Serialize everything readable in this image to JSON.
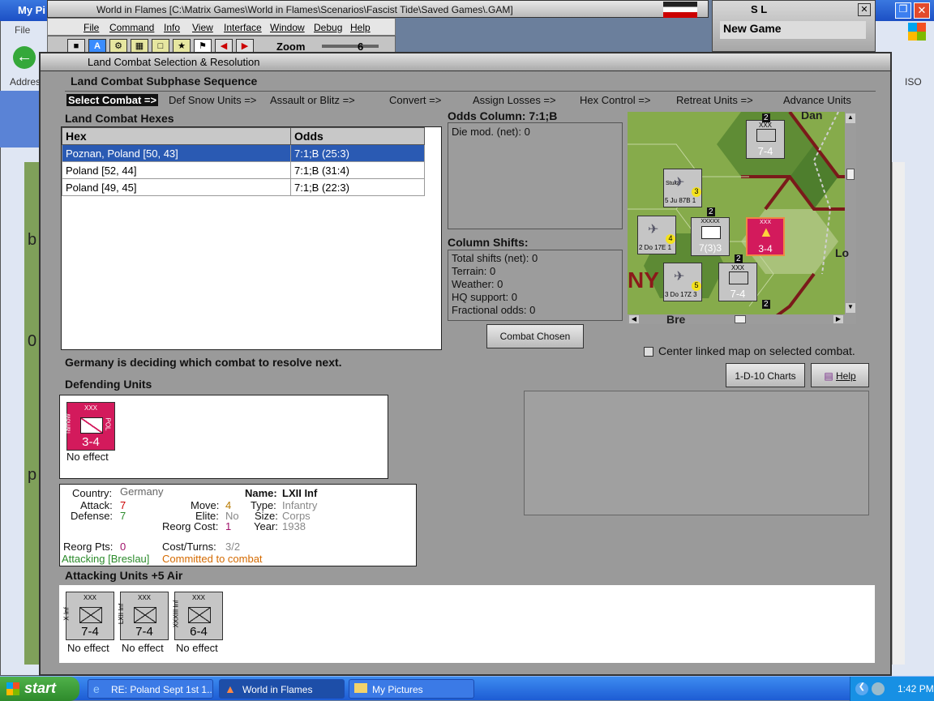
{
  "bg": {
    "my_pictures_title": "My Pi",
    "file_menu": "File",
    "address_label": "Addres",
    "side_letter1": "b",
    "side_letter2": "0",
    "side_letter3": "p",
    "right_letter": "ISO"
  },
  "sl_window": {
    "title": "S L",
    "new_game": "New Game"
  },
  "main_window": {
    "title": "World in Flames [C:\\Matrix Games\\World in Flames\\Scenarios\\Fascist Tide\\Saved Games\\.GAM]",
    "menu": [
      "File",
      "Command",
      "Info",
      "View",
      "Interface",
      "Window",
      "Debug",
      "Help"
    ],
    "zoom_label": "Zoom",
    "zoom_value": "6"
  },
  "dialog": {
    "title": "Land Combat Selection & Resolution",
    "sequence_title": "Land Combat Subphase Sequence",
    "sequence": [
      "Select Combat =>",
      "Def Snow Units =>",
      "Assault or Blitz =>",
      "Convert =>",
      "Assign Losses =>",
      "Hex Control =>",
      "Retreat Units =>",
      "Advance Units"
    ],
    "hexes_title": "Land Combat Hexes",
    "table": {
      "headers": [
        "Hex",
        "Odds"
      ],
      "rows": [
        [
          "Poznan, Poland [50, 43]",
          "7:1;B (25:3)"
        ],
        [
          "Poland [52, 44]",
          "7:1;B (31:4)"
        ],
        [
          "Poland [49, 45]",
          "7:1;B (22:3)"
        ]
      ]
    },
    "odds_column": "Odds Column: 7:1;B",
    "die_mod": "Die mod. (net): 0",
    "column_shifts_title": "Column Shifts:",
    "shifts": [
      "Total shifts (net): 0",
      "Terrain: 0",
      "Weather: 0",
      "HQ support: 0",
      "Fractional odds: 0"
    ],
    "combat_chosen": "Combat Chosen",
    "center_linked": "Center linked map on selected combat.",
    "charts_button": "1-D-10 Charts",
    "help_button": "Help",
    "status": "Germany is deciding which combat to resolve next.",
    "defending_title": "Defending Units",
    "defender": {
      "size": "XXX",
      "name": "Tarnow",
      "nation": "POL",
      "value": "3-4",
      "effect": "No effect"
    },
    "info": {
      "country_label": "Country:",
      "country": "Germany",
      "attack_label": "Attack:",
      "attack": "7",
      "defense_label": "Defense:",
      "defense": "7",
      "move_label": "Move:",
      "move": "4",
      "elite_label": "Elite:",
      "elite": "No",
      "reorg_cost_label": "Reorg Cost:",
      "reorg_cost": "1",
      "name_label": "Name:",
      "name": "LXII Inf",
      "type_label": "Type:",
      "type": "Infantry",
      "size_label": "Size:",
      "size": "Corps",
      "year_label": "Year:",
      "year": "1938",
      "reorg_pts_label": "Reorg Pts:",
      "reorg_pts": "0",
      "cost_turns_label": "Cost/Turns:",
      "cost_turns": "3/2",
      "attacking": "Attacking [Breslau]",
      "committed": "Committed to combat"
    },
    "attacking_title": "Attacking Units +5 Air",
    "attackers": [
      {
        "size": "XXX",
        "name": "X Inf",
        "value": "7-4",
        "effect": "No effect"
      },
      {
        "size": "XXX",
        "name": "LXII Inf",
        "value": "7-4",
        "effect": "No effect"
      },
      {
        "size": "XXX",
        "name": "XXXIII Inf",
        "value": "6-4",
        "effect": "No effect"
      }
    ],
    "map": {
      "label_dan": "Dan",
      "label_ny": "NY",
      "label_lo": "Lo",
      "label_bre": "Bre",
      "units": [
        {
          "top": "XXX",
          "value": "7-4"
        },
        {
          "top": "Stuka",
          "value": "5 Ju 87B 1",
          "badge": "3"
        },
        {
          "top": "",
          "value": "2 Do 17E 1",
          "badge": "4"
        },
        {
          "top": "XXXXX",
          "value": "7(3)3"
        },
        {
          "top": "XXX",
          "value": "3-4"
        },
        {
          "top": "XXX",
          "value": "7-4"
        },
        {
          "top": "",
          "value": "3 Do 17Z 3",
          "badge": "5"
        }
      ],
      "stack_counts": [
        "2",
        "2",
        "2",
        "2"
      ]
    }
  },
  "taskbar": {
    "start": "start",
    "tasks": [
      "RE: Poland Sept 1st 1...",
      "World in Flames",
      "My Pictures"
    ],
    "time": "1:42 PM"
  }
}
